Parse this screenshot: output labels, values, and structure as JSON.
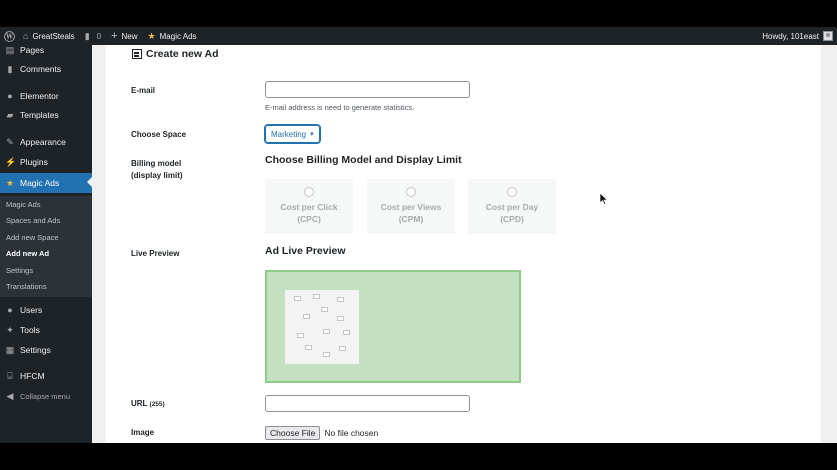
{
  "adminbar": {
    "site_name": "GreatSteals",
    "comments_count": "0",
    "new_label": "New",
    "plugin_label": "Magic Ads",
    "howdy": "Howdy, 101east"
  },
  "sidebar": {
    "items": [
      {
        "label": "Pages",
        "icon": "pages-icon"
      },
      {
        "label": "Comments",
        "icon": "comments-icon"
      },
      {
        "label": "Elementor",
        "icon": "elementor-icon"
      },
      {
        "label": "Templates",
        "icon": "templates-icon"
      },
      {
        "label": "Appearance",
        "icon": "appearance-icon"
      },
      {
        "label": "Plugins",
        "icon": "plugins-icon"
      },
      {
        "label": "Magic Ads",
        "icon": "magic-ads-icon"
      },
      {
        "label": "Users",
        "icon": "users-icon"
      },
      {
        "label": "Tools",
        "icon": "tools-icon"
      },
      {
        "label": "Settings",
        "icon": "settings-icon"
      },
      {
        "label": "HFCM",
        "icon": "hfcm-icon"
      },
      {
        "label": "Collapse menu",
        "icon": "collapse-icon"
      }
    ],
    "submenu": [
      {
        "label": "Magic Ads"
      },
      {
        "label": "Spaces and Ads"
      },
      {
        "label": "Add new Space"
      },
      {
        "label": "Add new Ad"
      },
      {
        "label": "Settings"
      },
      {
        "label": "Translations"
      }
    ]
  },
  "page": {
    "title": "Create new Ad"
  },
  "form": {
    "email_label": "E-mail",
    "email_value": "",
    "email_help": "E-mail address is need to generate statistics.",
    "space_label": "Choose Space",
    "space_value": "Marketing",
    "billing_label_1": "Billing model",
    "billing_label_2": "(display limit)",
    "billing_title": "Choose Billing Model and Display Limit",
    "billing_options": [
      {
        "line1": "Cost per Click",
        "line2": "(CPC)"
      },
      {
        "line1": "Cost per Views",
        "line2": "(CPM)"
      },
      {
        "line1": "Cost per Day",
        "line2": "(CPD)"
      }
    ],
    "preview_label": "Live Preview",
    "preview_title": "Ad Live Preview",
    "url_label": "URL",
    "url_limit": "(255)",
    "url_value": "",
    "image_label": "Image",
    "choose_file": "Choose File",
    "no_file": "No file chosen"
  },
  "colors": {
    "adminbar_bg": "#1d2327",
    "accent": "#2271b1",
    "preview_green": "#c3e1c0"
  }
}
